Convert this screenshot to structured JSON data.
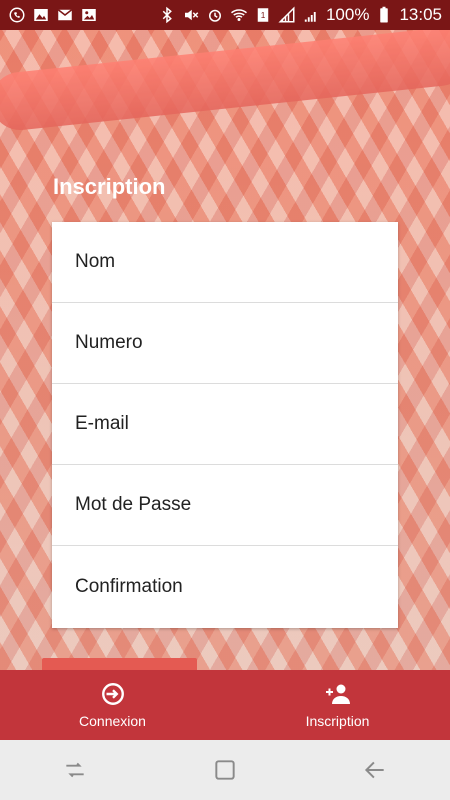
{
  "status_bar": {
    "battery": "100%",
    "time": "13:05",
    "icons_left": [
      "whatsapp-icon",
      "image-icon",
      "mail-icon",
      "gallery-icon"
    ],
    "icons_right": [
      "bluetooth-icon",
      "mute-icon",
      "alarm-icon",
      "wifi-icon",
      "sim-icon",
      "signal-icon",
      "signal2-icon",
      "battery-icon"
    ]
  },
  "page": {
    "title": "Inscription"
  },
  "form": {
    "fields": [
      {
        "name": "nom",
        "placeholder": "Nom"
      },
      {
        "name": "numero",
        "placeholder": "Numero"
      },
      {
        "name": "email",
        "placeholder": "E-mail"
      },
      {
        "name": "password",
        "placeholder": "Mot de Passe"
      },
      {
        "name": "confirmation",
        "placeholder": "Confirmation"
      }
    ]
  },
  "bottom_nav": {
    "items": [
      {
        "label": "Connexion",
        "icon": "login-icon"
      },
      {
        "label": "Inscription",
        "icon": "add-user-icon"
      }
    ],
    "color": "#c2353b"
  },
  "colors": {
    "status_bar": "#7a1616",
    "accent": "#c2353b"
  }
}
